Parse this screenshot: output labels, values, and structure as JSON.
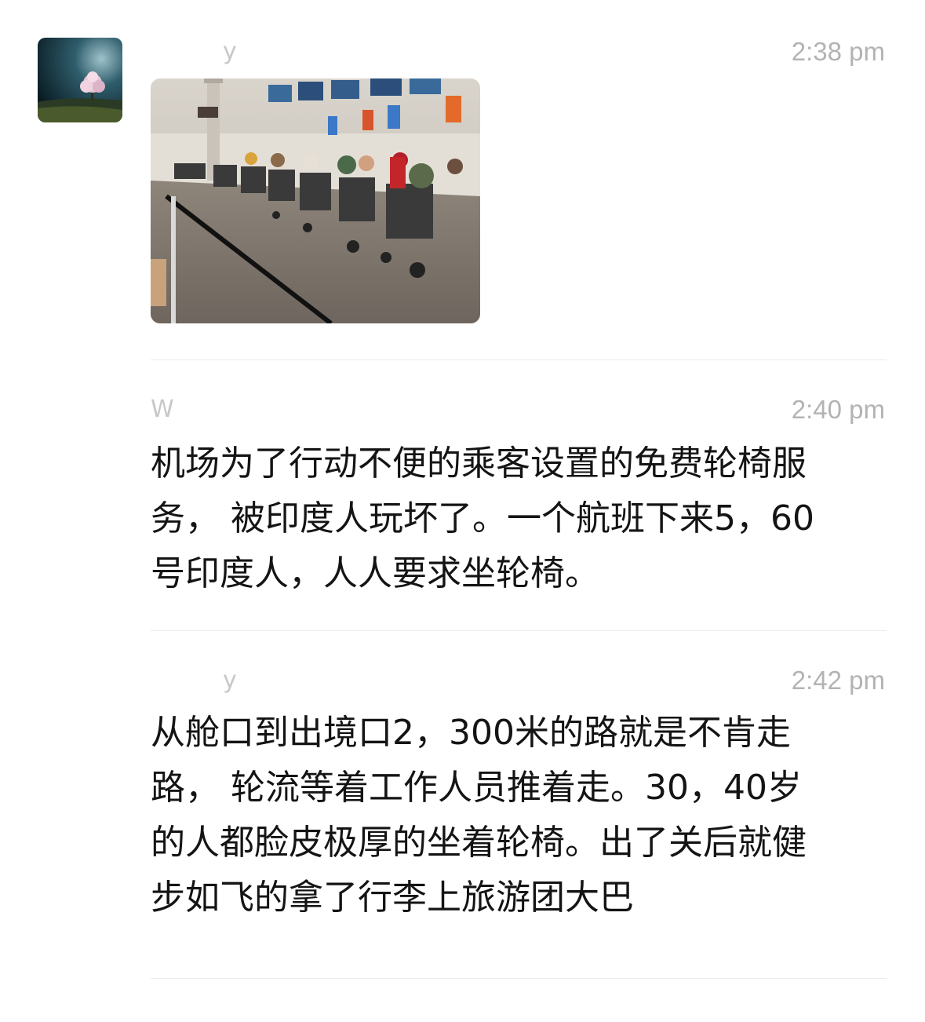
{
  "messages": [
    {
      "sender": "y",
      "time": "2:38 pm"
    },
    {
      "sender": "W",
      "time": "2:40 pm",
      "text": "机场为了行动不便的乘客设置的免费轮椅服\n务， 被印度人玩坏了。一个航班下来5，60\n号印度人，人人要求坐轮椅。"
    },
    {
      "sender": "y",
      "time": "2:42 pm",
      "text": "从舱口到出境口2，300米的路就是不肯走\n路， 轮流等着工作人员推着走。30，40岁\n的人都脸皮极厚的坐着轮椅。出了关后就健\n步如飞的拿了行李上旅游团大巴"
    }
  ],
  "colors": {
    "background": "#ffffff",
    "text": "#141414",
    "timestamp": "#b3b3b3",
    "divider": "#ececec"
  }
}
